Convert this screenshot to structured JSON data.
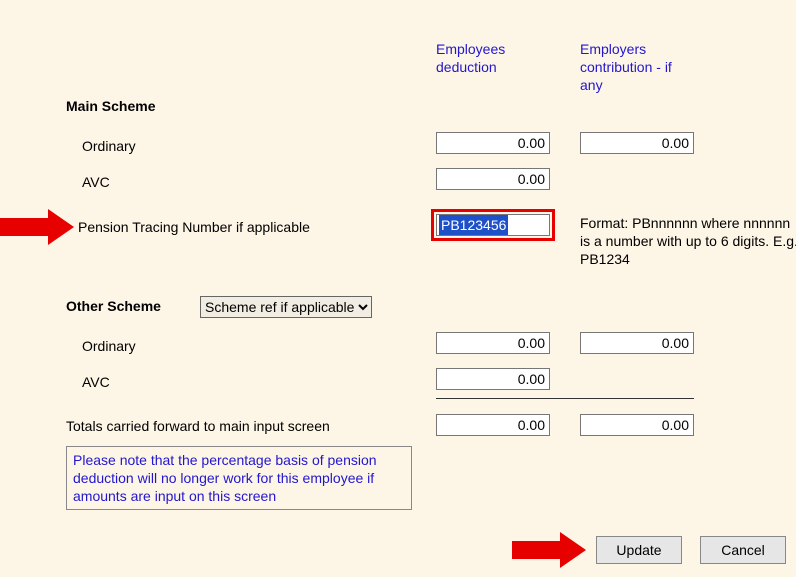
{
  "headers": {
    "employees": "Employees deduction",
    "employers": "Employers contribution - if any"
  },
  "main_scheme": {
    "title": "Main Scheme",
    "ordinary_label": "Ordinary",
    "avc_label": "AVC",
    "ordinary_emp": "0.00",
    "ordinary_emr": "0.00",
    "avc_emp": "0.00"
  },
  "ptn": {
    "label": "Pension Tracing Number if applicable",
    "value": "PB123456",
    "format_hint": "Format: PBnnnnnn where nnnnnn is a number with up to 6 digits. E.g. PB1234"
  },
  "other_scheme": {
    "title": "Other Scheme",
    "select_label": "Scheme ref if applicable",
    "ordinary_label": "Ordinary",
    "avc_label": "AVC",
    "ordinary_emp": "0.00",
    "ordinary_emr": "0.00",
    "avc_emp": "0.00"
  },
  "totals": {
    "label": "Totals carried forward to main input screen",
    "emp": "0.00",
    "emr": "0.00"
  },
  "note": "Please note that the percentage basis of pension deduction will no longer work for this employee if amounts are input on this screen",
  "buttons": {
    "update": "Update",
    "cancel": "Cancel"
  }
}
